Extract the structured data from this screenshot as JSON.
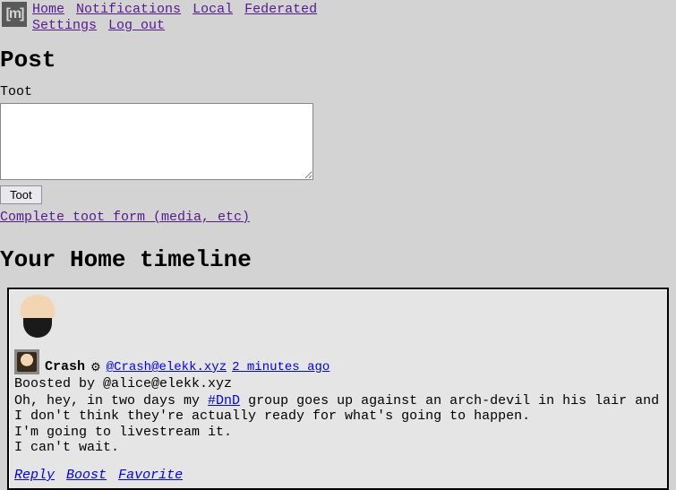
{
  "nav": {
    "home": "Home",
    "notifications": "Notifications",
    "local": "Local",
    "federated": "Federated",
    "settings": "Settings",
    "logout": "Log out"
  },
  "post": {
    "heading": "Post",
    "label": "Toot",
    "button": "Toot",
    "full_form_link": "Complete toot form (media, etc)"
  },
  "timeline": {
    "heading": "Your Home timeline"
  },
  "status": {
    "display_name": "Crash",
    "gear": "⚙",
    "handle": "@Crash@elekk.xyz",
    "time": "2 minutes ago",
    "boosted_by": "Boosted by @alice@elekk.xyz",
    "body_pre": "Oh, hey, in two days my ",
    "hashtag": "#DnD",
    "body_post": " group goes up against an arch-devil in his lair and I don't think they're actually ready for what's going to happen.",
    "line2": "I'm going to livestream it.",
    "line3": "I can't wait.",
    "actions": {
      "reply": "Reply",
      "boost": "Boost",
      "favorite": "Favorite"
    }
  }
}
